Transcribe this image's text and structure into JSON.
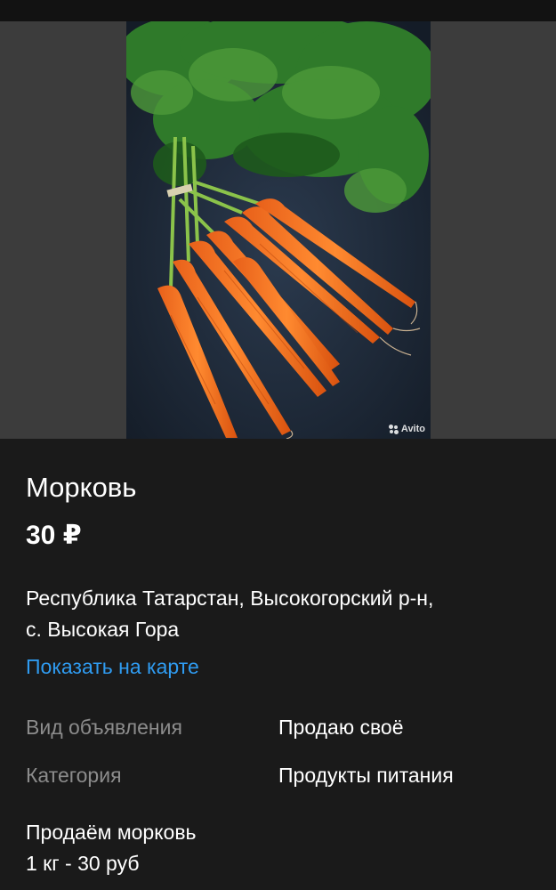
{
  "photo": {
    "watermark_text": "Avito",
    "watermark_icon": "avito-logo-icon"
  },
  "listing": {
    "title": "Морковь",
    "price": "30 ₽",
    "address_line1": "Республика Татарстан, Высокогорский р-н,",
    "address_line2": "с. Высокая Гора",
    "map_link": "Показать на карте"
  },
  "params": [
    {
      "label": "Вид объявления",
      "value": "Продаю своё"
    },
    {
      "label": "Категория",
      "value": "Продукты питания"
    }
  ],
  "description": {
    "line1": "Продаём морковь",
    "line2": "1 кг - 30 руб"
  },
  "colors": {
    "background": "#1a1a1a",
    "link": "#2f9bf0",
    "label_gray": "#8c8c8c"
  }
}
